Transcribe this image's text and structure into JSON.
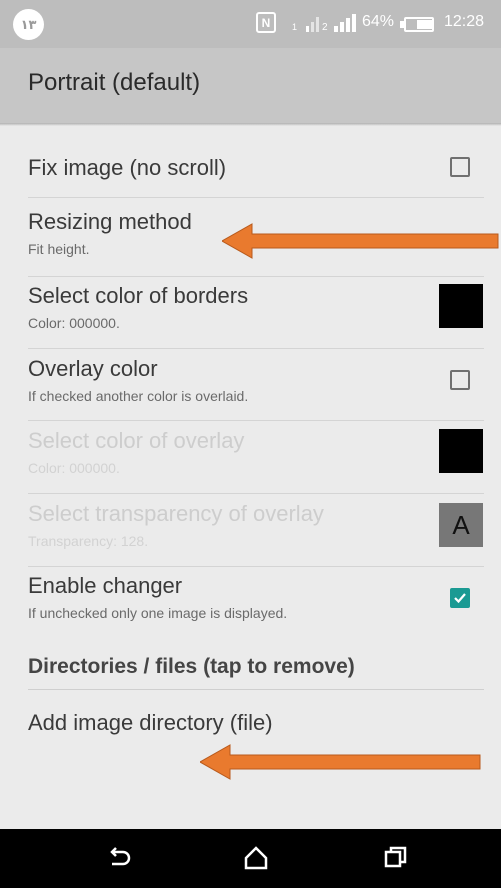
{
  "status_bar": {
    "badge": "١٣",
    "nfc": "N",
    "battery_percent": "64%",
    "battery_level": 0.64,
    "time": "12:28"
  },
  "header": {
    "title": "Portrait (default)"
  },
  "preferences": [
    {
      "title": "Fix image (no scroll)",
      "summary": "",
      "control": "checkbox",
      "checked": false,
      "enabled": true
    },
    {
      "title": "Resizing method",
      "summary": "Fit height.",
      "control": "none",
      "enabled": true
    },
    {
      "title": "Select color of borders",
      "summary": "Color: 000000.",
      "control": "color-swatch",
      "color": "#000000",
      "enabled": true
    },
    {
      "title": "Overlay color",
      "summary": "If checked another color is overlaid.",
      "control": "checkbox",
      "checked": false,
      "enabled": true
    },
    {
      "title": "Select color of overlay",
      "summary": "Color: 000000.",
      "control": "color-swatch",
      "color": "#000000",
      "enabled": false
    },
    {
      "title": "Select transparency of overlay",
      "summary": "Transparency: 128.",
      "control": "transparency-tile",
      "tile_label": "A",
      "enabled": false
    },
    {
      "title": "Enable changer",
      "summary": "If unchecked only one image is displayed.",
      "control": "checkbox",
      "checked": true,
      "enabled": true
    }
  ],
  "category": {
    "title": "Directories / files (tap to remove)"
  },
  "add_item": {
    "title": "Add image directory (file)"
  },
  "colors": {
    "accent": "#1b9a93",
    "arrow": "#e97a2e",
    "header_bg": "#c6c6c6",
    "page_bg": "#ebebeb"
  },
  "navigation": [
    "back-icon",
    "home-icon",
    "recents-icon"
  ]
}
